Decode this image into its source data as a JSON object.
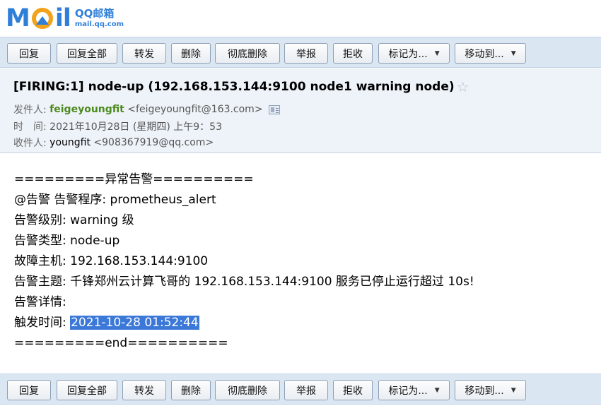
{
  "logo": {
    "cn": "QQ邮箱",
    "url": "mail.qq.com"
  },
  "toolbar": {
    "buttons": [
      "回复",
      "回复全部",
      "转发",
      "删除",
      "彻底删除",
      "举报",
      "拒收"
    ],
    "dropdowns": [
      "标记为...",
      "移动到..."
    ]
  },
  "email": {
    "subject": "[FIRING:1] node-up (192.168.153.144:9100 node1 warning node)",
    "from_label": "发件人:",
    "from_name": "feigeyoungfit",
    "from_addr": "<feigeyoungfit@163.com>",
    "time_label": "时　间:",
    "time_value": "2021年10月28日 (星期四) 上午9：53",
    "to_label": "收件人:",
    "to_name": "youngfit",
    "to_addr": "<908367919@qq.com>"
  },
  "body": {
    "l1": "=========异常告警==========",
    "l2": "@告警 告警程序: prometheus_alert",
    "l3": "告警级别: warning 级",
    "l4": "告警类型: node-up",
    "l5": "故障主机: 192.168.153.144:9100",
    "l6": "告警主题: 千锋郑州云计算飞哥的 192.168.153.144:9100 服务已停止运行超过 10s!",
    "l7": "告警详情:",
    "l8_label": "触发时间: ",
    "l8_value": "2021-10-28 01:52:44",
    "l9": "=========end=========="
  }
}
